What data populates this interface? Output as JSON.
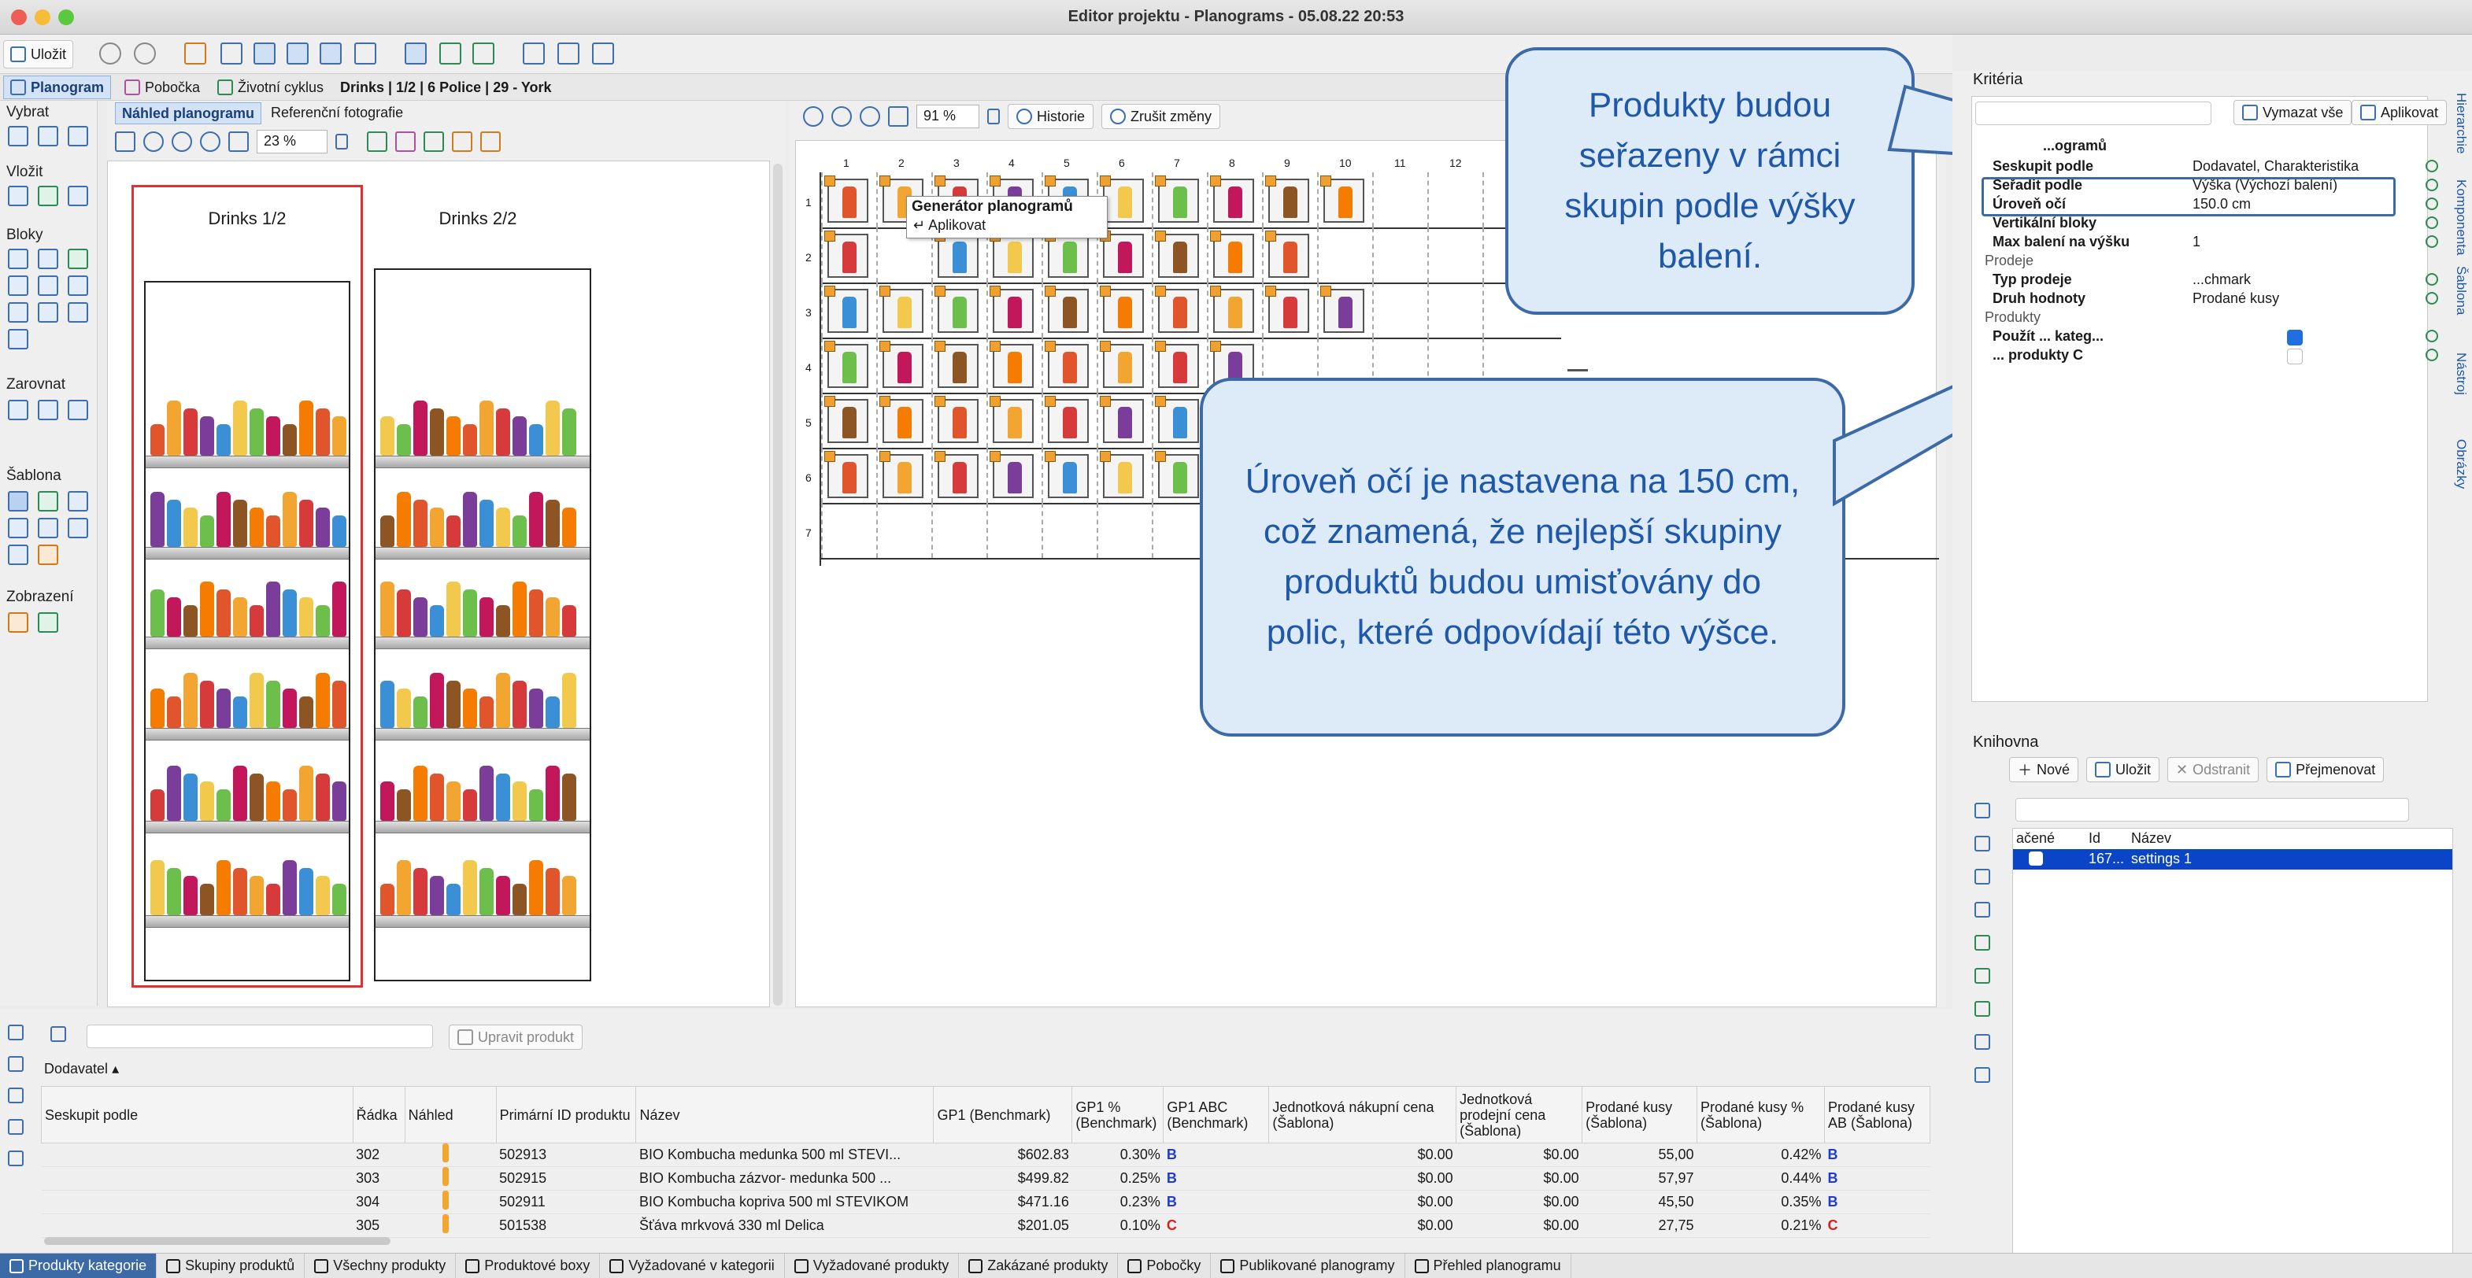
{
  "window": {
    "title": "Editor projektu - Planograms - 05.08.22 20:53"
  },
  "toolbar": {
    "save_label": "Uložit"
  },
  "tabs": {
    "planogram": "Planogram",
    "branch": "Pobočka",
    "lifecycle": "Životní cyklus",
    "context": "Drinks | 1/2 | 6 Police | 29 - York"
  },
  "sidebar": {
    "select": "Vybrat",
    "insert": "Vložit",
    "blocks": "Bloky",
    "align": "Zarovnat",
    "template": "Šablona",
    "view": "Zobrazení"
  },
  "preview": {
    "tab_preview": "Náhled planogramu",
    "tab_photos": "Referenční fotografie",
    "zoom": "23 %",
    "unit1": "Drinks 1/2",
    "unit2": "Drinks 2/2"
  },
  "editor": {
    "zoom": "91 %",
    "history": "Historie",
    "discard": "Zrušit změny",
    "tooltip_title": "Generátor planogramů",
    "tooltip_apply": "Aplikovat",
    "col_numbers": [
      "1",
      "2",
      "3",
      "4",
      "5",
      "6",
      "7",
      "8",
      "9",
      "10",
      "11",
      "12"
    ],
    "row_numbers": [
      "1",
      "2",
      "3",
      "4",
      "5",
      "6",
      "7"
    ]
  },
  "callouts": {
    "top": "Produkty budou seřazeny v rámci skupin podle výšky balení.",
    "bottom": "Úroveň očí je nastavena na 150 cm, což znamená, že nejlepší skupiny produktů budou umisťovány do polic, které odpovídají této výšce."
  },
  "criteria": {
    "title": "Kritéria",
    "clear_all": "Vymazat vše",
    "apply": "Aplikovat",
    "group_header": "...ogramů",
    "rows": [
      {
        "k": "Seskupit podle",
        "v": "Dodavatel, Charakteristika"
      },
      {
        "k": "Seřadit podle",
        "v": "Výška (Výchozí balení)"
      },
      {
        "k": "Úroveň očí",
        "v": "150.0 cm"
      },
      {
        "k": "Vertikální bloky",
        "v": ""
      },
      {
        "k": "Max balení na výšku",
        "v": "1"
      }
    ],
    "sales_section": "Prodeje",
    "sales_rows": [
      {
        "k": "Typ prodeje",
        "v": "...chmark"
      },
      {
        "k": "Druh hodnoty",
        "v": "Prodané kusy"
      }
    ],
    "products_section": "Produkty",
    "products_rows": [
      {
        "k": "Použít ... kateg...",
        "v": ""
      },
      {
        "k": "... produkty C",
        "v": ""
      }
    ]
  },
  "library": {
    "title": "Knihovna",
    "new": "Nové",
    "save": "Uložit",
    "remove": "Odstranit",
    "rename": "Přejmenovat",
    "col1": "ačené",
    "col2": "Id",
    "col3": "Název",
    "row_id": "167...",
    "row_name": "settings 1"
  },
  "products": {
    "edit": "Upravit produkt",
    "group_filter": "Dodavatel",
    "headers": [
      "Seskupit podle",
      "Řádka",
      "Náhled",
      "Primární ID produktu",
      "Název",
      "GP1 (Benchmark)",
      "GP1 % (Benchmark)",
      "GP1 ABC (Benchmark)",
      "Jednotková nákupní cena (Šablona)",
      "Jednotková prodejní cena (Šablona)",
      "Prodané kusy (Šablona)",
      "Prodané kusy % (Šablona)",
      "Prodané kusy AB (Šablona)"
    ],
    "rows": [
      {
        "row": "302",
        "id": "502913",
        "name": "BIO Kombucha medunka 500 ml STEVI...",
        "gp1": "$602.83",
        "pct": "0.30%",
        "abc": "B",
        "buy": "$0.00",
        "sell": "$0.00",
        "qty": "55,00",
        "qpct": "0.42%",
        "qabc": "B"
      },
      {
        "row": "303",
        "id": "502915",
        "name": "BIO Kombucha zázvor- medunka 500 ...",
        "gp1": "$499.82",
        "pct": "0.25%",
        "abc": "B",
        "buy": "$0.00",
        "sell": "$0.00",
        "qty": "57,97",
        "qpct": "0.44%",
        "qabc": "B"
      },
      {
        "row": "304",
        "id": "502911",
        "name": "BIO Kombucha kopriva 500 ml STEVIKOM",
        "gp1": "$471.16",
        "pct": "0.23%",
        "abc": "B",
        "buy": "$0.00",
        "sell": "$0.00",
        "qty": "45,50",
        "qpct": "0.35%",
        "qabc": "B"
      },
      {
        "row": "305",
        "id": "501538",
        "name": "Šťáva mrkvová 330 ml Delica",
        "gp1": "$201.05",
        "pct": "0.10%",
        "abc": "C",
        "buy": "$0.00",
        "sell": "$0.00",
        "qty": "27,75",
        "qpct": "0.21%",
        "qabc": "C"
      }
    ]
  },
  "statusbar": [
    "Produkty kategorie",
    "Skupiny produktů",
    "Všechny produkty",
    "Produktové boxy",
    "Vyžadované v kategorii",
    "Vyžadované produkty",
    "Zakázané produkty",
    "Pobočky",
    "Publikované planogramy",
    "Přehled planogramu"
  ],
  "vertical_tabs": [
    "Hierarchie",
    "Komponenta",
    "Šablona",
    "Nástroj",
    "Obrázky"
  ],
  "colors": {
    "accent": "#3b6aa6",
    "callout_fill": "#ddeaf8",
    "abc_b": "#1f3bd6",
    "abc_c": "#d62020",
    "selected_row": "#0b45c7"
  }
}
